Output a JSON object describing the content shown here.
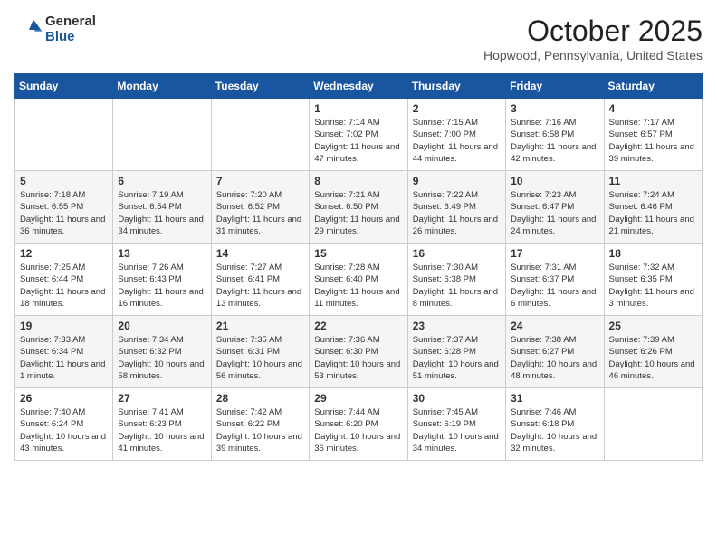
{
  "logo": {
    "general": "General",
    "blue": "Blue"
  },
  "title": "October 2025",
  "location": "Hopwood, Pennsylvania, United States",
  "days_of_week": [
    "Sunday",
    "Monday",
    "Tuesday",
    "Wednesday",
    "Thursday",
    "Friday",
    "Saturday"
  ],
  "weeks": [
    [
      {
        "num": "",
        "info": ""
      },
      {
        "num": "",
        "info": ""
      },
      {
        "num": "",
        "info": ""
      },
      {
        "num": "1",
        "info": "Sunrise: 7:14 AM\nSunset: 7:02 PM\nDaylight: 11 hours and 47 minutes."
      },
      {
        "num": "2",
        "info": "Sunrise: 7:15 AM\nSunset: 7:00 PM\nDaylight: 11 hours and 44 minutes."
      },
      {
        "num": "3",
        "info": "Sunrise: 7:16 AM\nSunset: 6:58 PM\nDaylight: 11 hours and 42 minutes."
      },
      {
        "num": "4",
        "info": "Sunrise: 7:17 AM\nSunset: 6:57 PM\nDaylight: 11 hours and 39 minutes."
      }
    ],
    [
      {
        "num": "5",
        "info": "Sunrise: 7:18 AM\nSunset: 6:55 PM\nDaylight: 11 hours and 36 minutes."
      },
      {
        "num": "6",
        "info": "Sunrise: 7:19 AM\nSunset: 6:54 PM\nDaylight: 11 hours and 34 minutes."
      },
      {
        "num": "7",
        "info": "Sunrise: 7:20 AM\nSunset: 6:52 PM\nDaylight: 11 hours and 31 minutes."
      },
      {
        "num": "8",
        "info": "Sunrise: 7:21 AM\nSunset: 6:50 PM\nDaylight: 11 hours and 29 minutes."
      },
      {
        "num": "9",
        "info": "Sunrise: 7:22 AM\nSunset: 6:49 PM\nDaylight: 11 hours and 26 minutes."
      },
      {
        "num": "10",
        "info": "Sunrise: 7:23 AM\nSunset: 6:47 PM\nDaylight: 11 hours and 24 minutes."
      },
      {
        "num": "11",
        "info": "Sunrise: 7:24 AM\nSunset: 6:46 PM\nDaylight: 11 hours and 21 minutes."
      }
    ],
    [
      {
        "num": "12",
        "info": "Sunrise: 7:25 AM\nSunset: 6:44 PM\nDaylight: 11 hours and 18 minutes."
      },
      {
        "num": "13",
        "info": "Sunrise: 7:26 AM\nSunset: 6:43 PM\nDaylight: 11 hours and 16 minutes."
      },
      {
        "num": "14",
        "info": "Sunrise: 7:27 AM\nSunset: 6:41 PM\nDaylight: 11 hours and 13 minutes."
      },
      {
        "num": "15",
        "info": "Sunrise: 7:28 AM\nSunset: 6:40 PM\nDaylight: 11 hours and 11 minutes."
      },
      {
        "num": "16",
        "info": "Sunrise: 7:30 AM\nSunset: 6:38 PM\nDaylight: 11 hours and 8 minutes."
      },
      {
        "num": "17",
        "info": "Sunrise: 7:31 AM\nSunset: 6:37 PM\nDaylight: 11 hours and 6 minutes."
      },
      {
        "num": "18",
        "info": "Sunrise: 7:32 AM\nSunset: 6:35 PM\nDaylight: 11 hours and 3 minutes."
      }
    ],
    [
      {
        "num": "19",
        "info": "Sunrise: 7:33 AM\nSunset: 6:34 PM\nDaylight: 11 hours and 1 minute."
      },
      {
        "num": "20",
        "info": "Sunrise: 7:34 AM\nSunset: 6:32 PM\nDaylight: 10 hours and 58 minutes."
      },
      {
        "num": "21",
        "info": "Sunrise: 7:35 AM\nSunset: 6:31 PM\nDaylight: 10 hours and 56 minutes."
      },
      {
        "num": "22",
        "info": "Sunrise: 7:36 AM\nSunset: 6:30 PM\nDaylight: 10 hours and 53 minutes."
      },
      {
        "num": "23",
        "info": "Sunrise: 7:37 AM\nSunset: 6:28 PM\nDaylight: 10 hours and 51 minutes."
      },
      {
        "num": "24",
        "info": "Sunrise: 7:38 AM\nSunset: 6:27 PM\nDaylight: 10 hours and 48 minutes."
      },
      {
        "num": "25",
        "info": "Sunrise: 7:39 AM\nSunset: 6:26 PM\nDaylight: 10 hours and 46 minutes."
      }
    ],
    [
      {
        "num": "26",
        "info": "Sunrise: 7:40 AM\nSunset: 6:24 PM\nDaylight: 10 hours and 43 minutes."
      },
      {
        "num": "27",
        "info": "Sunrise: 7:41 AM\nSunset: 6:23 PM\nDaylight: 10 hours and 41 minutes."
      },
      {
        "num": "28",
        "info": "Sunrise: 7:42 AM\nSunset: 6:22 PM\nDaylight: 10 hours and 39 minutes."
      },
      {
        "num": "29",
        "info": "Sunrise: 7:44 AM\nSunset: 6:20 PM\nDaylight: 10 hours and 36 minutes."
      },
      {
        "num": "30",
        "info": "Sunrise: 7:45 AM\nSunset: 6:19 PM\nDaylight: 10 hours and 34 minutes."
      },
      {
        "num": "31",
        "info": "Sunrise: 7:46 AM\nSunset: 6:18 PM\nDaylight: 10 hours and 32 minutes."
      },
      {
        "num": "",
        "info": ""
      }
    ]
  ]
}
